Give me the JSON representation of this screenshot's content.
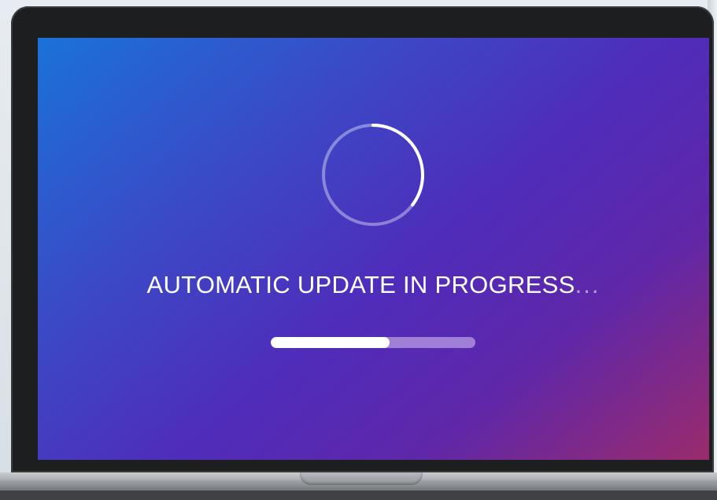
{
  "status_text": "AUTOMATIC UPDATE IN PROGRESS",
  "status_suffix": "...",
  "progress": 0.58,
  "colors": {
    "screen_gradient_start": "#1a72d9",
    "screen_gradient_mid": "#4f2cba",
    "screen_gradient_end": "#9a2b6c",
    "progress_fill": "#ffffff",
    "progress_track": "#a07fd8"
  },
  "icons": {
    "spinner": "loading-spinner-icon"
  }
}
